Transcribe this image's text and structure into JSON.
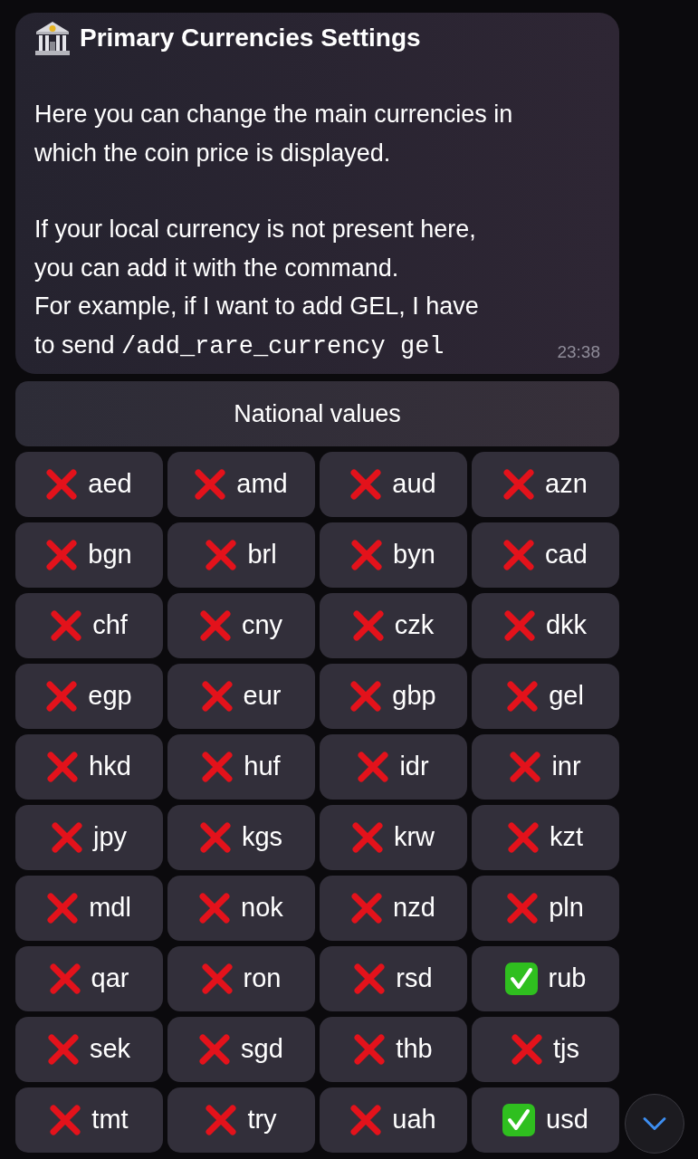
{
  "message": {
    "title": "Primary Currencies Settings",
    "paragraphs": [
      {
        "lines": [
          "Here you can change the main currencies in",
          "which the coin price is displayed."
        ]
      },
      {
        "lines": [
          "If your local currency is not present here,",
          "you can add it with the command.",
          "For example, if I want to add GEL, I have",
          "to send"
        ],
        "command": "/add_rare_currency gel"
      }
    ],
    "time": "23:38"
  },
  "keyboard": {
    "header_button": "National values",
    "currencies": [
      {
        "code": "aed",
        "checked": false
      },
      {
        "code": "amd",
        "checked": false
      },
      {
        "code": "aud",
        "checked": false
      },
      {
        "code": "azn",
        "checked": false
      },
      {
        "code": "bgn",
        "checked": false
      },
      {
        "code": "brl",
        "checked": false
      },
      {
        "code": "byn",
        "checked": false
      },
      {
        "code": "cad",
        "checked": false
      },
      {
        "code": "chf",
        "checked": false
      },
      {
        "code": "cny",
        "checked": false
      },
      {
        "code": "czk",
        "checked": false
      },
      {
        "code": "dkk",
        "checked": false
      },
      {
        "code": "egp",
        "checked": false
      },
      {
        "code": "eur",
        "checked": false
      },
      {
        "code": "gbp",
        "checked": false
      },
      {
        "code": "gel",
        "checked": false
      },
      {
        "code": "hkd",
        "checked": false
      },
      {
        "code": "huf",
        "checked": false
      },
      {
        "code": "idr",
        "checked": false
      },
      {
        "code": "inr",
        "checked": false
      },
      {
        "code": "jpy",
        "checked": false
      },
      {
        "code": "kgs",
        "checked": false
      },
      {
        "code": "krw",
        "checked": false
      },
      {
        "code": "kzt",
        "checked": false
      },
      {
        "code": "mdl",
        "checked": false
      },
      {
        "code": "nok",
        "checked": false
      },
      {
        "code": "nzd",
        "checked": false
      },
      {
        "code": "pln",
        "checked": false
      },
      {
        "code": "qar",
        "checked": false
      },
      {
        "code": "ron",
        "checked": false
      },
      {
        "code": "rsd",
        "checked": false
      },
      {
        "code": "rub",
        "checked": true
      },
      {
        "code": "sek",
        "checked": false
      },
      {
        "code": "sgd",
        "checked": false
      },
      {
        "code": "thb",
        "checked": false
      },
      {
        "code": "tjs",
        "checked": false
      },
      {
        "code": "tmt",
        "checked": false
      },
      {
        "code": "try",
        "checked": false
      },
      {
        "code": "uah",
        "checked": false
      },
      {
        "code": "usd",
        "checked": true
      }
    ]
  }
}
